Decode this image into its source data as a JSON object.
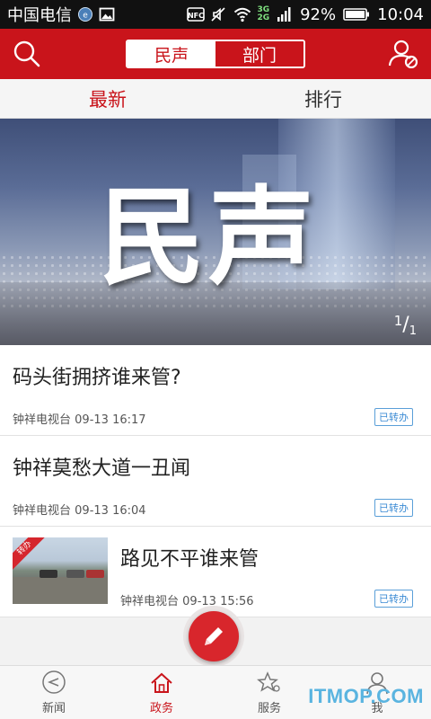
{
  "status_bar": {
    "carrier": "中国电信",
    "network": "3G",
    "network2": "2G",
    "battery": "92%",
    "time": "10:04",
    "icons": [
      "carrier-badge-icon",
      "image-icon",
      "nfc-icon",
      "mute-icon",
      "wifi-icon",
      "signal-icon",
      "battery-icon"
    ]
  },
  "header": {
    "segments": [
      {
        "label": "民声",
        "active": true
      },
      {
        "label": "部门",
        "active": false
      }
    ],
    "accent": "#c9141b"
  },
  "subtabs": [
    {
      "label": "最新",
      "active": true
    },
    {
      "label": "排行",
      "active": false
    }
  ],
  "banner": {
    "text": "民声",
    "page_current": "1",
    "page_separator": "/",
    "page_total": "1"
  },
  "news": [
    {
      "title": "码头街拥挤谁来管?",
      "source": "钟祥电视台",
      "time": "09-13 16:17",
      "status": "已转办"
    },
    {
      "title": "钟祥莫愁大道一丑闻",
      "source": "钟祥电视台",
      "time": "09-13 16:04",
      "status": "已转办"
    },
    {
      "title": "路见不平谁来管",
      "source": "钟祥电视台",
      "time": "09-13 15:56",
      "status": "已转办",
      "thumb_ribbon": "转办"
    }
  ],
  "fab": {
    "icon": "pencil-icon"
  },
  "bottom_nav": [
    {
      "label": "新闻",
      "icon": "news-icon",
      "active": false
    },
    {
      "label": "政务",
      "icon": "home-icon",
      "active": true
    },
    {
      "label": "服务",
      "icon": "star-icon",
      "active": false
    },
    {
      "label": "我",
      "icon": "person-icon",
      "active": false
    }
  ],
  "watermark": "ITMOP.COM"
}
